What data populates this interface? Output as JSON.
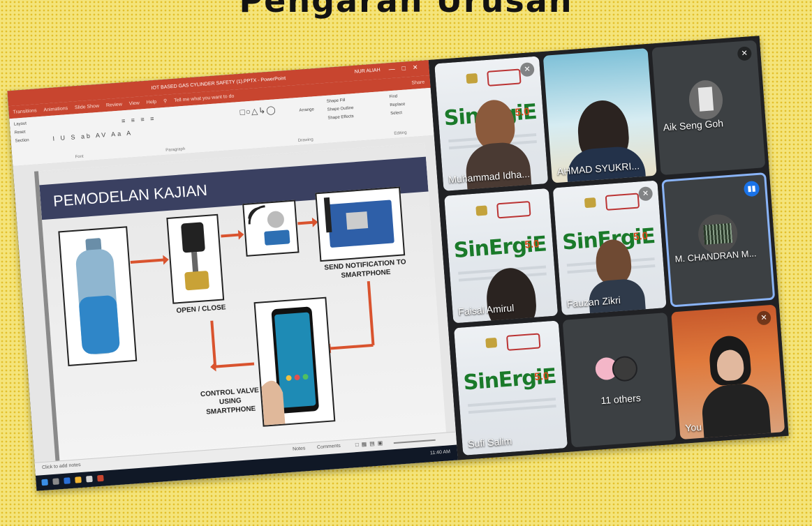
{
  "header": {
    "title": "Pengarah Urusan"
  },
  "powerpoint": {
    "window_title": "IOT BASED GAS CYLINDER SAFETY (1).PPTX  -  PowerPoint",
    "user": "NUR ALIAH",
    "tabs": [
      "Transitions",
      "Animations",
      "Slide Show",
      "Review",
      "View",
      "Help"
    ],
    "tell_me": "Tell me what you want to do",
    "share": "Share",
    "ribbon": {
      "paragraph": "Paragraph",
      "drawing": "Drawing",
      "editing": "Editing",
      "font": "Font",
      "find": "Find",
      "replace": "Replace",
      "select": "Select",
      "arrange": "Arrange",
      "quick_styles": "Quick Styles",
      "shape_fill": "Shape Fill",
      "shape_outline": "Shape Outline",
      "shape_effects": "Shape Effects",
      "layout": "Layout",
      "reset": "Reset",
      "section": "Section"
    },
    "slide": {
      "title": "PEMODELAN KAJIAN",
      "labels": {
        "open_close": "OPEN / CLOSE",
        "send_notification": "SEND NOTIFICATION TO SMARTPHONE",
        "control": "CONTROL VALVE USING SMARTPHONE"
      }
    },
    "status": {
      "notes": "Click to add notes",
      "notes_btn": "Notes",
      "comments_btn": "Comments"
    },
    "taskbar": {
      "time": "11:40 AM"
    }
  },
  "meet": {
    "participants": [
      {
        "name": "Muhammad Idha..."
      },
      {
        "name": "AHMAD SYUKRI..."
      },
      {
        "name": "Aik Seng Goh"
      },
      {
        "name": "Faisal Amirul"
      },
      {
        "name": "Fauzan Zikri"
      },
      {
        "name": "M. CHANDRAN M..."
      },
      {
        "name": "Sufi Salim"
      },
      {
        "name": "11 others"
      },
      {
        "name": "You"
      }
    ],
    "poster": {
      "brand": "SinErgiE",
      "version": "5.0"
    }
  },
  "colors": {
    "accent_blue": "#1a73e8",
    "ppt_red": "#c8452f",
    "slide_header": "#3a4061"
  }
}
